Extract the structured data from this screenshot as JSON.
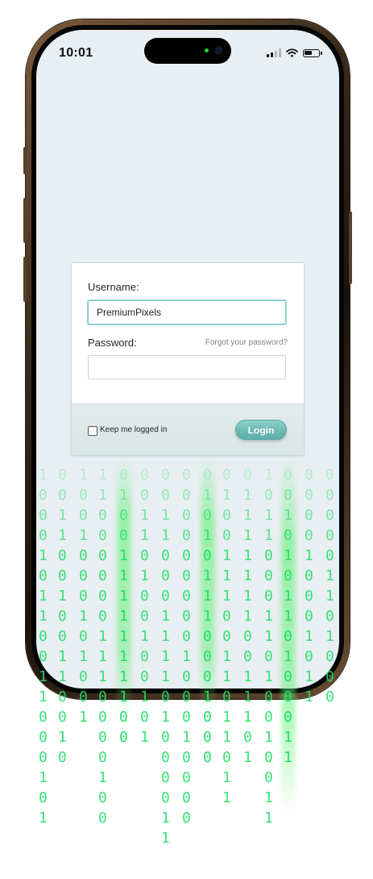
{
  "status_bar": {
    "time": "10:01",
    "icons": [
      "cellular-signal-icon",
      "wifi-icon",
      "battery-icon"
    ],
    "battery_level": 0.6
  },
  "login_form": {
    "username_label": "Username:",
    "username_value": "PremiumPixels",
    "password_label": "Password:",
    "password_value": "",
    "forgot_link": "Forgot your password?",
    "keep_logged_in_label": "Keep me logged in",
    "keep_logged_in_checked": false,
    "login_button": "Login"
  },
  "decoration": {
    "binary_digits": [
      "0",
      "1"
    ],
    "digit_color": "#22e06a"
  },
  "colors": {
    "screen_background": "#e9eef2",
    "accent": "#6bbab4",
    "frame": "#3a2a1c"
  }
}
